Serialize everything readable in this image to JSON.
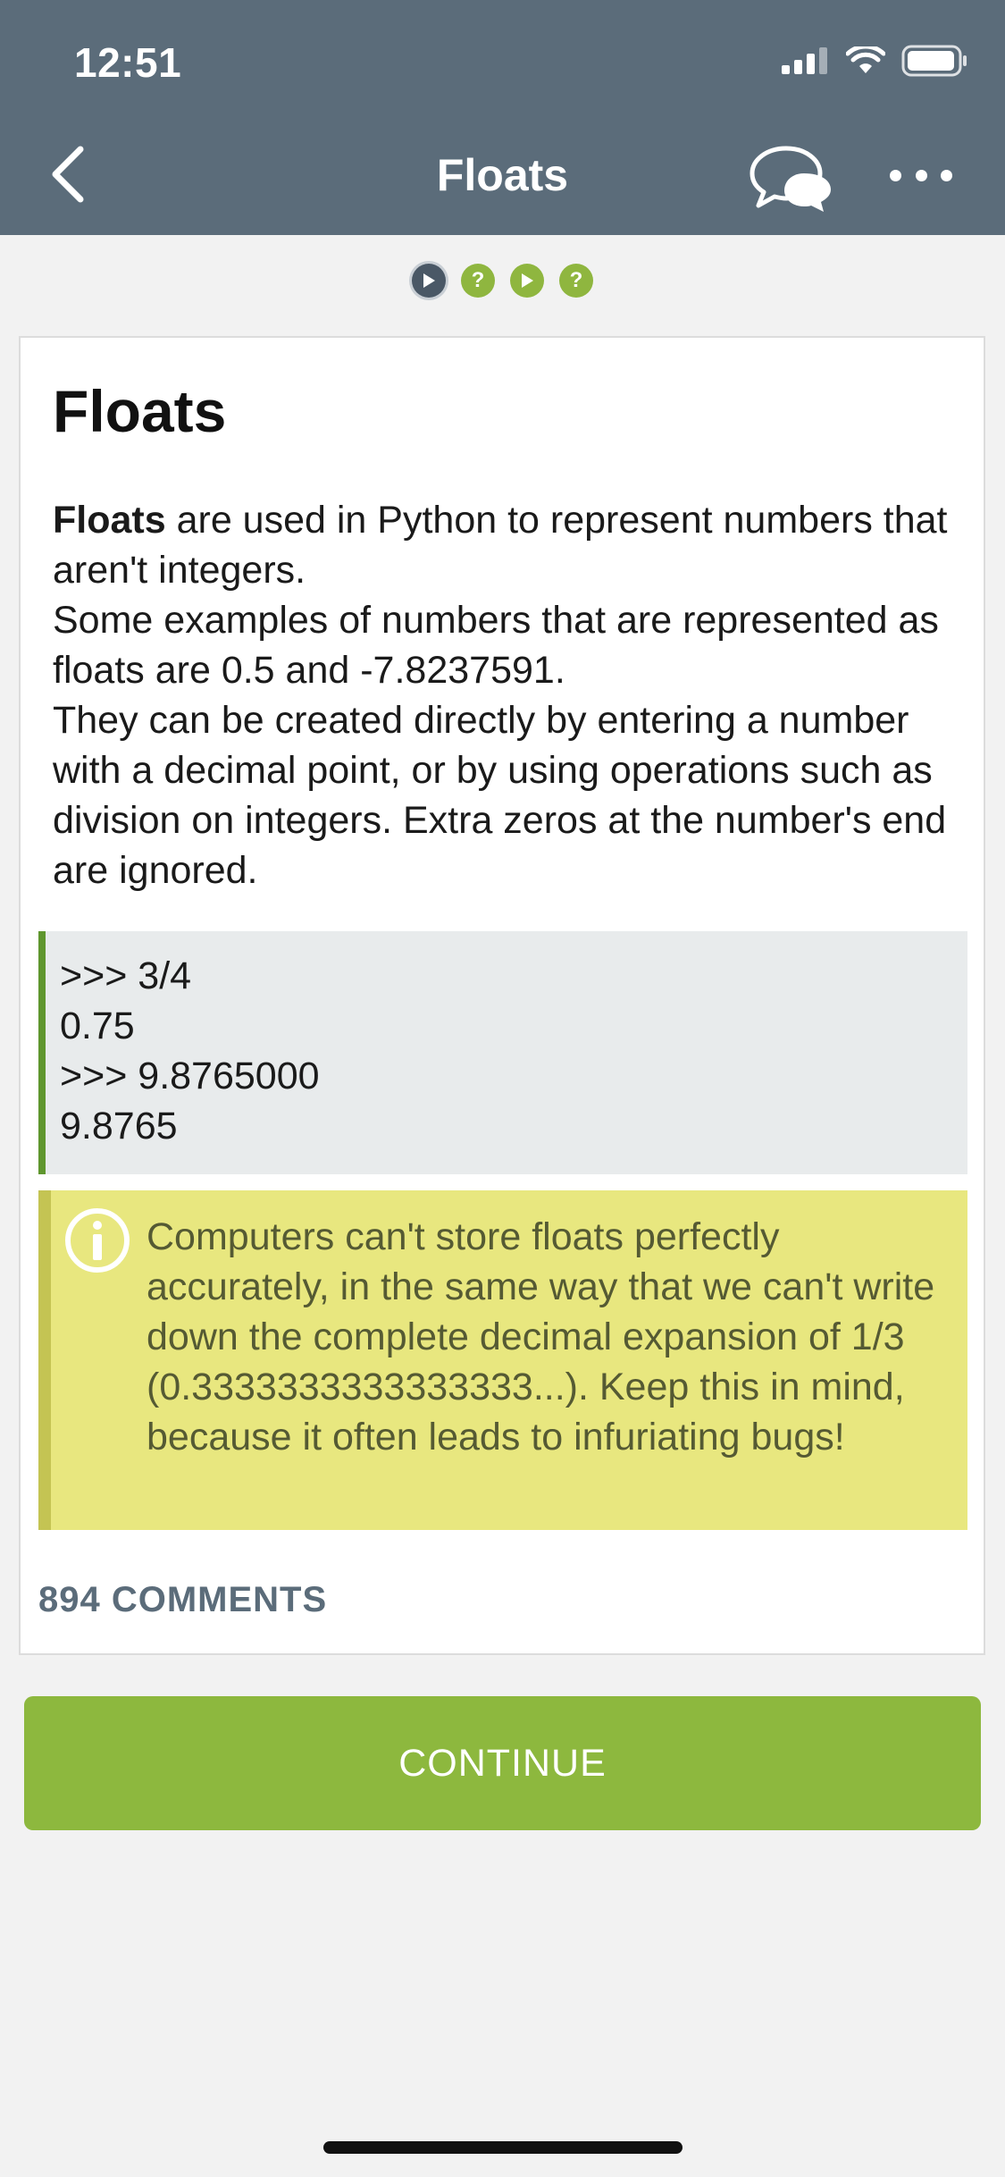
{
  "status_bar": {
    "time": "12:51",
    "icons": [
      "signal-icon",
      "wifi-icon",
      "battery-icon"
    ]
  },
  "nav": {
    "title": "Floats",
    "back_icon": "chevron-left-icon",
    "comments_icon": "chat-bubbles-icon",
    "more_icon": "more-dots-icon"
  },
  "progress": {
    "steps": [
      {
        "type": "play",
        "glyph": "▶",
        "state": "current"
      },
      {
        "type": "quiz",
        "glyph": "?",
        "state": "upcoming"
      },
      {
        "type": "play",
        "glyph": "▶",
        "state": "upcoming"
      },
      {
        "type": "quiz",
        "glyph": "?",
        "state": "upcoming"
      }
    ]
  },
  "lesson": {
    "title": "Floats",
    "paragraph1_bold": "Floats",
    "paragraph1_rest": " are used in Python to represent numbers that aren't integers.",
    "paragraph2": "Some examples of numbers that are represented as floats are 0.5 and -7.8237591.",
    "paragraph3": "They can be created directly by entering a number with a decimal point, or by using operations such as division on integers. Extra zeros at the number's end are ignored.",
    "code_lines": [
      ">>> 3/4",
      "0.75",
      ">>> 9.8765000",
      "9.8765"
    ],
    "note": "Computers can't store floats perfectly accurately, in the same way that we can't write down the complete decimal expansion of 1/3 (0.3333333333333333...). Keep this in mind, because it often leads to infuriating bugs!",
    "comments_label": "894 COMMENTS"
  },
  "actions": {
    "continue_label": "CONTINUE"
  },
  "colors": {
    "header": "#5b6c7a",
    "accent_green": "#8db83e",
    "code_border": "#5f962e",
    "note_background": "#e8e77f"
  }
}
